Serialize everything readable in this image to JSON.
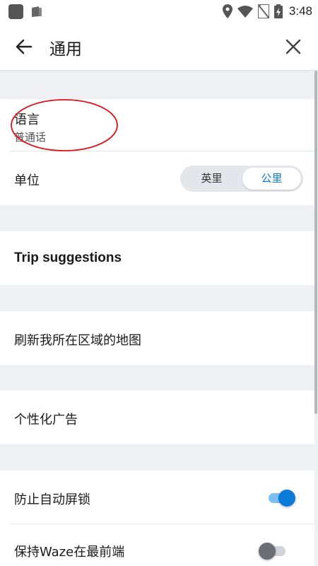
{
  "status_bar": {
    "time": "3:48",
    "icons": [
      "app-icon",
      "wallet-icon",
      "location-icon",
      "wifi-icon",
      "sim-off-icon",
      "battery-charging-icon"
    ]
  },
  "header": {
    "title": "通用",
    "back_icon": "arrow-left-icon",
    "close_icon": "close-icon"
  },
  "settings": {
    "language": {
      "title": "语言",
      "value": "普通话"
    },
    "units": {
      "title": "单位",
      "options": [
        "英里",
        "公里"
      ],
      "selected": "公里"
    },
    "trip": {
      "title": "Trip suggestions"
    },
    "refresh_map": {
      "title": "刷新我所在区域的地图"
    },
    "personalized_ads": {
      "title": "个性化广告"
    },
    "prevent_lock": {
      "title": "防止自动屏锁",
      "enabled": true
    },
    "keep_front": {
      "title": "保持Waze在最前端",
      "enabled": false
    }
  },
  "colors": {
    "accent": "#0c7bd8",
    "annotation": "#e0101a",
    "background": "#eef0f3"
  }
}
